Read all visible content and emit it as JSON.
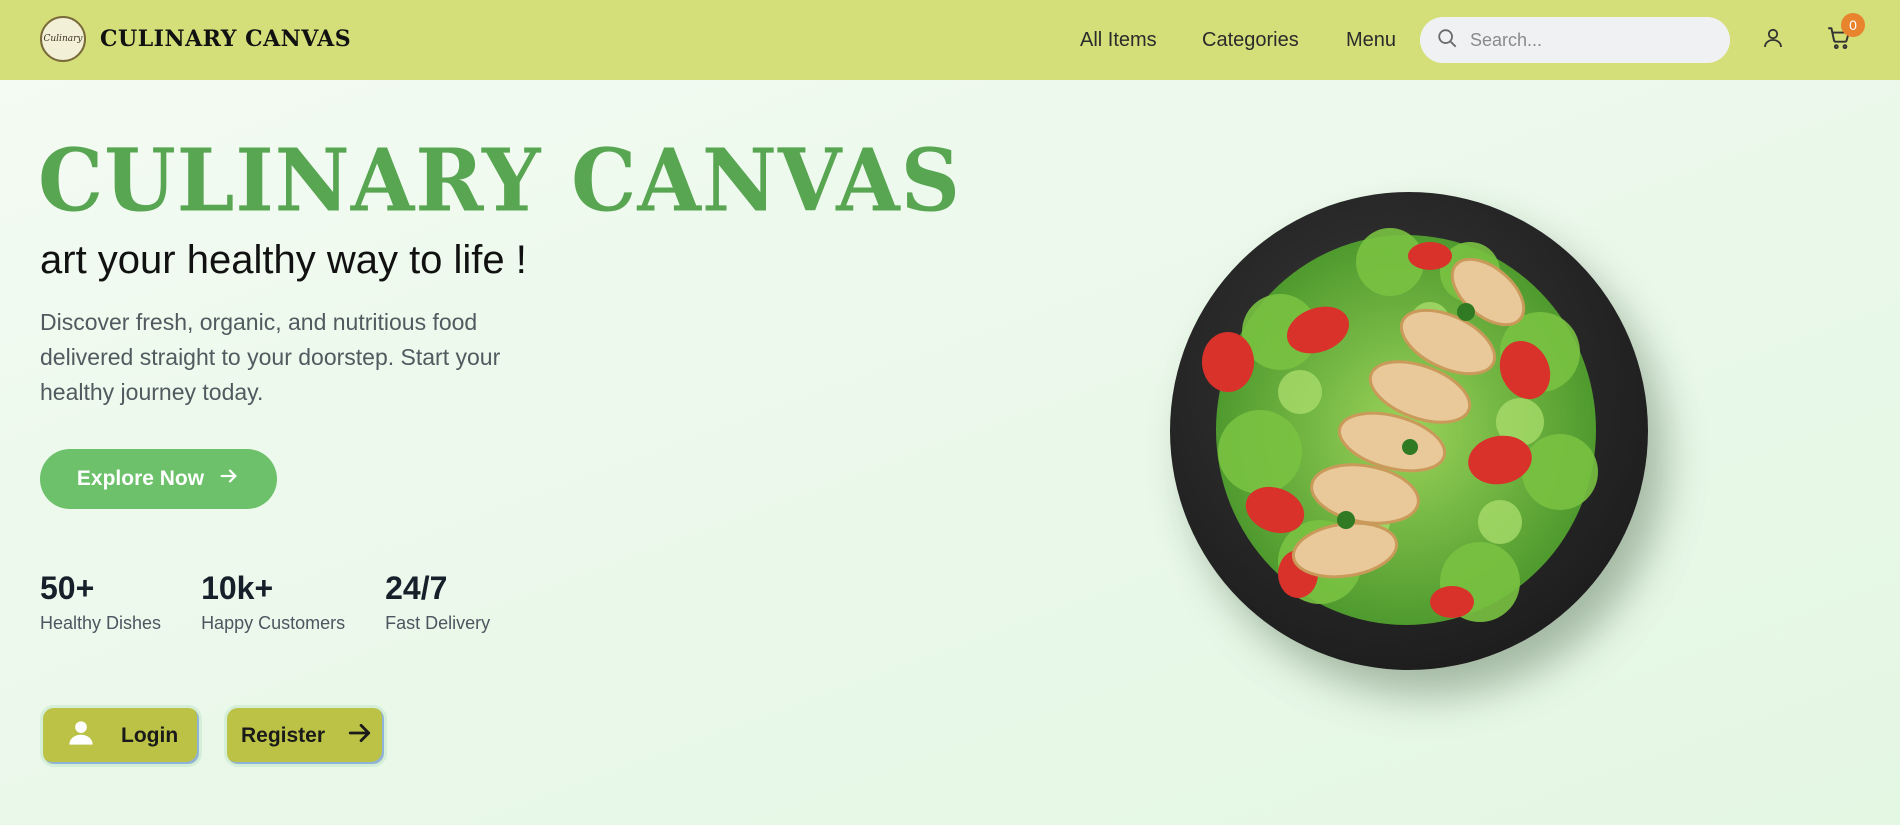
{
  "brand": {
    "name": "CULINARY CANVAS",
    "logo_text": "Culinary"
  },
  "nav": {
    "items": [
      "All Items",
      "Categories",
      "Menu"
    ]
  },
  "search": {
    "placeholder": "Search..."
  },
  "cart": {
    "count": "0"
  },
  "hero": {
    "title": "CULINARY CANVAS",
    "subtitle": "art your healthy way to life !",
    "description": "Discover fresh, organic, and nutritious food delivered straight to your doorstep. Start your healthy journey today.",
    "cta_label": "Explore Now"
  },
  "stats": [
    {
      "value": "50+",
      "label": "Healthy Dishes"
    },
    {
      "value": "10k+",
      "label": "Happy Customers"
    },
    {
      "value": "24/7",
      "label": "Fast Delivery"
    }
  ],
  "auth": {
    "login_label": "Login",
    "register_label": "Register"
  },
  "colors": {
    "header_bg": "#d4df7a",
    "title_green": "#58a552",
    "cta_green": "#6cc16a",
    "auth_button": "#bcc245",
    "badge_orange": "#e8842e"
  },
  "icons": {
    "search": "search-icon",
    "user": "user-icon",
    "cart": "cart-icon",
    "arrow": "arrow-right-icon"
  }
}
